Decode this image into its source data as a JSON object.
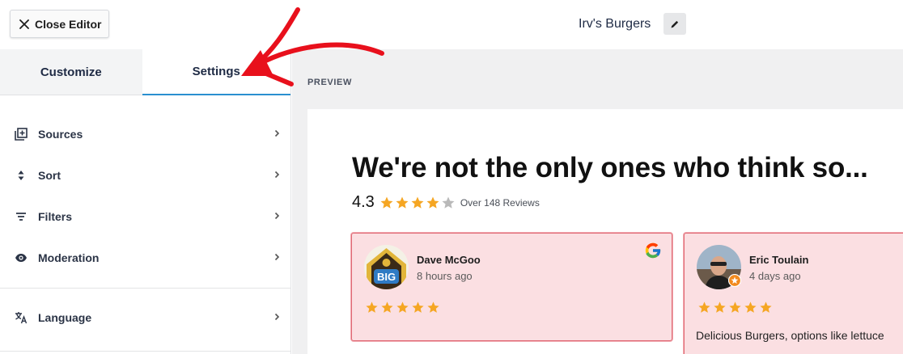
{
  "toolbar": {
    "close_label": "Close Editor",
    "page_title": "Irv's Burgers"
  },
  "sidebar": {
    "tabs": [
      {
        "label": "Customize"
      },
      {
        "label": "Settings"
      }
    ],
    "items": [
      {
        "label": "Sources",
        "icon": "sources-icon"
      },
      {
        "label": "Sort",
        "icon": "sort-icon"
      },
      {
        "label": "Filters",
        "icon": "filter-icon"
      },
      {
        "label": "Moderation",
        "icon": "eye-icon"
      },
      {
        "label": "Language",
        "icon": "translate-icon"
      }
    ]
  },
  "preview": {
    "label": "PREVIEW",
    "headline": "We're not the only ones who think so...",
    "rating": "4.3",
    "rating_stars": 4.3,
    "reviews_count": "Over 148 Reviews",
    "reviews": [
      {
        "name": "Dave McGoo",
        "time": "8 hours ago",
        "stars": 5,
        "source": "google-logo-icon",
        "text": ""
      },
      {
        "name": "Eric Toulain",
        "time": "4 days ago",
        "stars": 5,
        "text": "Delicious Burgers, options like lettuce"
      }
    ]
  },
  "colors": {
    "accent_tab": "#2a8fd0",
    "star": "#f5a623",
    "star_empty": "#b9b9b9",
    "card_bg": "#fbdfe2",
    "card_border": "#e06b76",
    "annotation_arrow": "#e8101c"
  }
}
